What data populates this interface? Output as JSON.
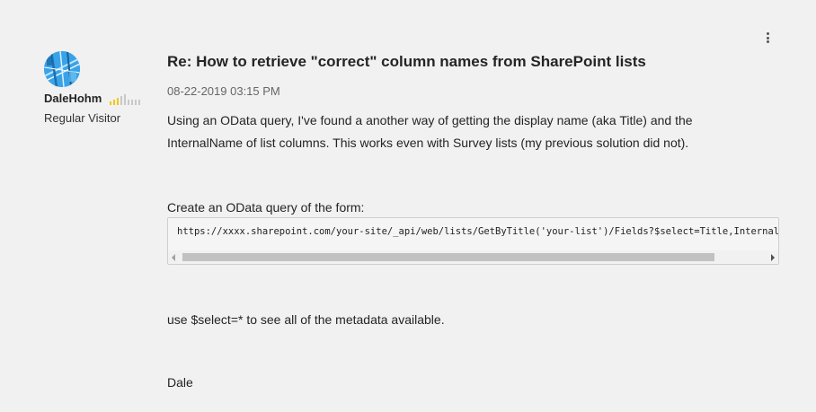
{
  "author": {
    "name": "DaleHohm",
    "rank": "Regular Visitor",
    "avatar_icon": "avatar-blue-pattern",
    "rank_level": 3,
    "rank_max": 5
  },
  "menu": {
    "icon": "kebab-menu-icon"
  },
  "post": {
    "title": "Re: How to retrieve \"correct\" column names from SharePoint lists",
    "date": "08-22-2019 03:15 PM",
    "paragraph1": "Using an OData query, I've found a another way of getting the display name (aka Title) and the InternalName of list columns.  This works even with Survey lists (my previous solution did not).",
    "paragraph2": "Create an OData query of the form:",
    "code": "https://xxxx.sharepoint.com/your-site/_api/web/lists/GetByTitle('your-list')/Fields?$select=Title,InternalName",
    "paragraph3": "use $select=* to see all of the metadata available.",
    "signature": "Dale"
  },
  "colors": {
    "background": "#f1f1f1",
    "rank_active": "#f2c811",
    "rank_inactive": "#c8c8c8"
  }
}
